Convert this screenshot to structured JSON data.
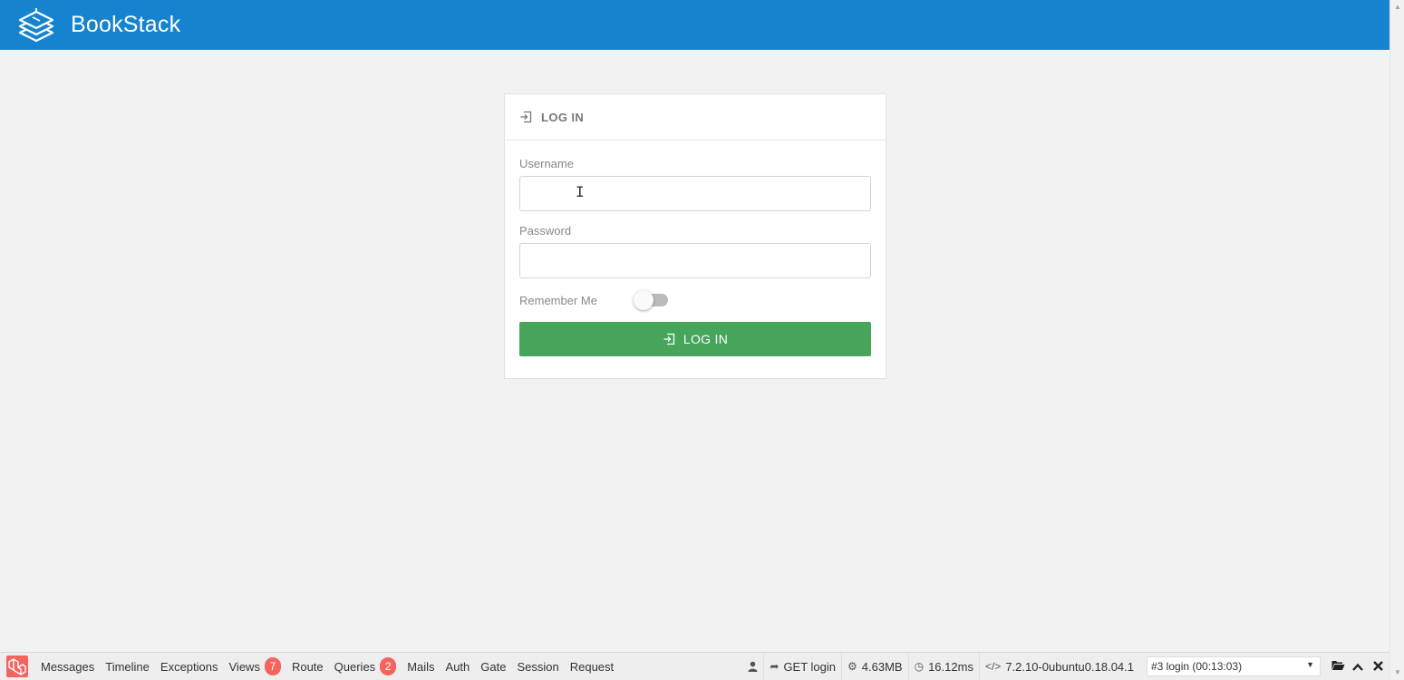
{
  "header": {
    "app_name": "BookStack",
    "brand_color": "#1583cf"
  },
  "login_card": {
    "title": "LOG IN",
    "username_label": "Username",
    "username_value": "",
    "password_label": "Password",
    "password_value": "",
    "remember_label": "Remember Me",
    "remember_on": false,
    "submit_label": "LOG IN",
    "submit_color": "#47a45b"
  },
  "debugbar": {
    "tabs": [
      {
        "label": "Messages",
        "badge": ""
      },
      {
        "label": "Timeline",
        "badge": ""
      },
      {
        "label": "Exceptions",
        "badge": ""
      },
      {
        "label": "Views",
        "badge": "7"
      },
      {
        "label": "Route",
        "badge": ""
      },
      {
        "label": "Queries",
        "badge": "2"
      },
      {
        "label": "Mails",
        "badge": ""
      },
      {
        "label": "Auth",
        "badge": ""
      },
      {
        "label": "Gate",
        "badge": ""
      },
      {
        "label": "Session",
        "badge": ""
      },
      {
        "label": "Request",
        "badge": ""
      }
    ],
    "route": "GET login",
    "memory": "4.63MB",
    "time": "16.12ms",
    "php_version": "7.2.10-0ubuntu0.18.04.1",
    "request_select": "#3 login (00:13:03)",
    "icons": {
      "user": "user-icon",
      "route": "share-icon",
      "memory": "cogs-icon",
      "time": "clock-icon",
      "php": "code-icon",
      "open": "folder-open-icon",
      "maximize": "chevron-up-icon",
      "close": "close-icon"
    }
  }
}
